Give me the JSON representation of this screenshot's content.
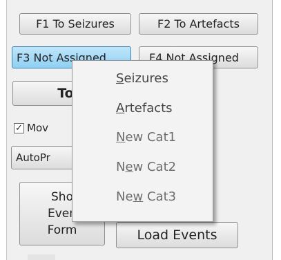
{
  "buttons": {
    "f1": "F1 To Seizures",
    "f2": "F2 To Artefacts",
    "f3": "F3 Not Assigned",
    "f4": "F4 Not Assigned",
    "to": "To",
    "autopr": "AutoPr",
    "show_l1": "Sho",
    "show_l2": "Even",
    "show_l3": "Form",
    "load_events": "Load Events"
  },
  "checkbox": {
    "label": "Mov",
    "checked_mark": "✓"
  },
  "context_menu": {
    "items": [
      {
        "pre": "",
        "u": "S",
        "post": "eizures"
      },
      {
        "pre": "",
        "u": "A",
        "post": "rtefacts"
      },
      {
        "pre": "",
        "u": "N",
        "post": "ew Cat1"
      },
      {
        "pre": "N",
        "u": "e",
        "post": "w Cat2"
      },
      {
        "pre": "Ne",
        "u": "w",
        "post": " Cat3"
      }
    ]
  }
}
